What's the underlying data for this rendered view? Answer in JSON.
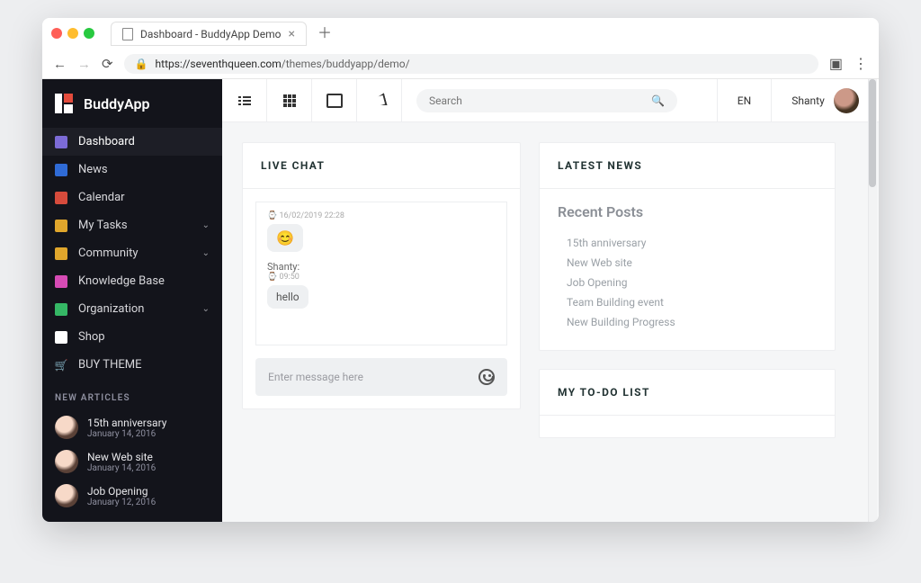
{
  "browser": {
    "tab_title": "Dashboard - BuddyApp Demo",
    "url_display": "https://seventhqueen.com/themes/buddyapp/demo/",
    "url_protocol": "https://",
    "url_host": "seventhqueen.com",
    "url_path": "/themes/buddyapp/demo/"
  },
  "brand": {
    "name": "BuddyApp"
  },
  "sidebar": {
    "items": [
      {
        "label": "Dashboard",
        "icon": "sliders-icon",
        "color": "c-sliders",
        "chev": false,
        "active": true
      },
      {
        "label": "News",
        "icon": "news-icon",
        "color": "c-news",
        "chev": false
      },
      {
        "label": "Calendar",
        "icon": "calendar-icon",
        "color": "c-cal",
        "chev": false
      },
      {
        "label": "My Tasks",
        "icon": "tasks-icon",
        "color": "c-tasks",
        "chev": true
      },
      {
        "label": "Community",
        "icon": "community-icon",
        "color": "c-comm",
        "chev": true
      },
      {
        "label": "Knowledge Base",
        "icon": "book-icon",
        "color": "c-kb",
        "chev": false
      },
      {
        "label": "Organization",
        "icon": "org-icon",
        "color": "c-org",
        "chev": true
      },
      {
        "label": "Shop",
        "icon": "shop-icon",
        "color": "c-shop",
        "chev": false
      },
      {
        "label": "BUY THEME",
        "icon": "cart-icon",
        "color": "c-cart",
        "chev": false
      }
    ],
    "section_title": "NEW ARTICLES",
    "articles": [
      {
        "title": "15th anniversary",
        "date": "January 14, 2016"
      },
      {
        "title": "New Web site",
        "date": "January 14, 2016"
      },
      {
        "title": "Job Opening",
        "date": "January 12, 2016"
      }
    ]
  },
  "topbar": {
    "search_placeholder": "Search",
    "lang": "EN",
    "user_name": "Shanty"
  },
  "chat": {
    "title": "LIVE CHAT",
    "msgs": [
      {
        "meta": "16/02/2019 22:28",
        "text": "😊",
        "whoLabel": ""
      },
      {
        "meta": "09:50",
        "text": "hello",
        "whoLabel": "Shanty:"
      }
    ],
    "input_placeholder": "Enter message here"
  },
  "news": {
    "title": "LATEST NEWS",
    "subtitle": "Recent Posts",
    "posts": [
      "15th anniversary",
      "New Web site",
      "Job Opening",
      "Team Building event",
      "New Building Progress"
    ]
  },
  "todo": {
    "title": "MY TO-DO LIST"
  }
}
